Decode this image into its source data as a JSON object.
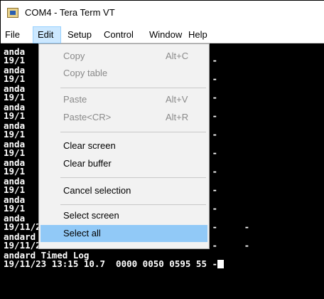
{
  "window": {
    "title": "COM4 - Tera Term VT"
  },
  "menubar": {
    "items": [
      {
        "label": "File"
      },
      {
        "label": "Edit"
      },
      {
        "label": "Setup"
      },
      {
        "label": "Control"
      },
      {
        "label": "Window"
      },
      {
        "label": "Help"
      }
    ]
  },
  "edit_menu": {
    "copy": {
      "label": "Copy",
      "shortcut": "Alt+C",
      "enabled": false
    },
    "copy_table": {
      "label": "Copy table",
      "enabled": false
    },
    "paste": {
      "label": "Paste",
      "shortcut": "Alt+V",
      "enabled": false
    },
    "paste_cr": {
      "label": "Paste<CR>",
      "shortcut": "Alt+R",
      "enabled": false
    },
    "clear_screen": {
      "label": "Clear screen",
      "enabled": true
    },
    "clear_buffer": {
      "label": "Clear buffer",
      "enabled": true
    },
    "cancel_selection": {
      "label": "Cancel selection",
      "enabled": true
    },
    "select_screen": {
      "label": "Select screen",
      "enabled": true
    },
    "select_all": {
      "label": "Select all",
      "enabled": true,
      "highlighted": true
    }
  },
  "terminal": {
    "lines": [
      "anda",
      "19/1                     0623 55 -     -",
      "anda",
      "19/1                     0617 55 -     -",
      "anda",
      "19/1                     0608 55 -     -",
      "anda",
      "19/1                     0609 55 -     -",
      "anda",
      "19/1                     0606 55 -     -",
      "anda",
      "19/1                     0610 55 -     -",
      "anda",
      "19/1                     0611 55 -     -",
      "anda",
      "19/1                     0601 55 -     -",
      "anda",
      "19/1                     0637 55 -     -",
      "anda",
      "19/11/23 11:13 10.7  0000 0050 0612 55 -     -",
      "andard Timed Log",
      "19/11/23 12:14 10.7  0000 0050 0590 55 -     -",
      "andard Timed Log",
      "19/11/23 13:15 10.7  0000 0050 0595 55 -"
    ]
  },
  "colors": {
    "menu_highlight": "#91c9f7",
    "active_menu": "#cce8ff",
    "terminal_bg": "#000000",
    "terminal_fg": "#ffffff"
  }
}
